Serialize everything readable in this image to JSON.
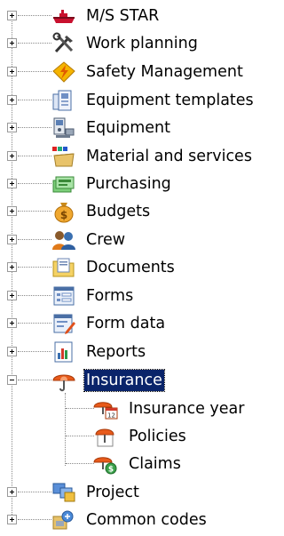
{
  "tree": {
    "items": [
      {
        "label": "M/S STAR",
        "icon": "ship-icon",
        "expanded": false
      },
      {
        "label": "Work planning",
        "icon": "tools-icon",
        "expanded": false
      },
      {
        "label": "Safety Management",
        "icon": "safety-icon",
        "expanded": false
      },
      {
        "label": "Equipment templates",
        "icon": "equipment-templates-icon",
        "expanded": false
      },
      {
        "label": "Equipment",
        "icon": "equipment-icon",
        "expanded": false
      },
      {
        "label": "Material and services",
        "icon": "materials-icon",
        "expanded": false
      },
      {
        "label": "Purchasing",
        "icon": "purchasing-icon",
        "expanded": false
      },
      {
        "label": "Budgets",
        "icon": "money-bag-icon",
        "expanded": false
      },
      {
        "label": "Crew",
        "icon": "crew-icon",
        "expanded": false
      },
      {
        "label": "Documents",
        "icon": "documents-icon",
        "expanded": false
      },
      {
        "label": "Forms",
        "icon": "forms-icon",
        "expanded": false
      },
      {
        "label": "Form data",
        "icon": "form-data-icon",
        "expanded": false
      },
      {
        "label": "Reports",
        "icon": "reports-icon",
        "expanded": false
      },
      {
        "label": "Insurance",
        "icon": "umbrella-icon",
        "expanded": true,
        "selected": true,
        "children": [
          {
            "label": "Insurance year",
            "icon": "insurance-year-icon"
          },
          {
            "label": "Policies",
            "icon": "policies-icon"
          },
          {
            "label": "Claims",
            "icon": "claims-icon"
          }
        ]
      },
      {
        "label": "Project",
        "icon": "project-icon",
        "expanded": false
      },
      {
        "label": "Common codes",
        "icon": "common-codes-icon",
        "expanded": false
      }
    ]
  }
}
